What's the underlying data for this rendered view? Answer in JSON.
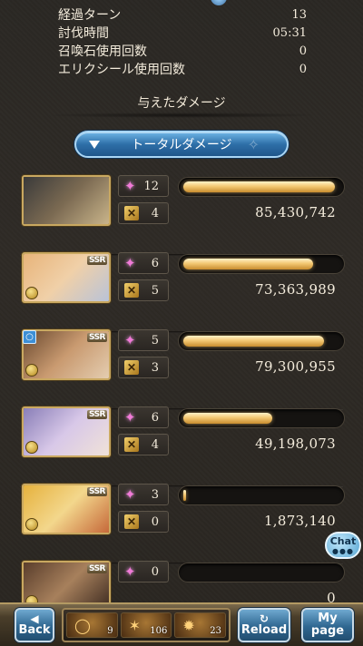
{
  "stats": {
    "rows": [
      {
        "label": "経過ターン",
        "value": "13"
      },
      {
        "label": "討伐時間",
        "value": "05:31"
      },
      {
        "label": "召喚石使用回数",
        "value": "0"
      },
      {
        "label": "エリクシール使用回数",
        "value": "0"
      }
    ]
  },
  "section_title": "与えたダメージ",
  "total_button": {
    "label": "トータルダメージ"
  },
  "characters": [
    {
      "stars": "12",
      "attacks": "4",
      "damage": "85,430,742",
      "bar_fraction": 0.97,
      "ssr": "",
      "art": [
        "#3a3a3a",
        "#7b6a52",
        "#c9b48a"
      ]
    },
    {
      "stars": "6",
      "attacks": "5",
      "damage": "73,363,989",
      "bar_fraction": 0.83,
      "ssr": "SSR",
      "art": [
        "#e8b47a",
        "#f0d0a8",
        "#b9c3d8"
      ]
    },
    {
      "stars": "5",
      "attacks": "3",
      "damage": "79,300,955",
      "bar_fraction": 0.9,
      "ssr": "SSR",
      "art": [
        "#6b4a30",
        "#c99a70",
        "#e4cdb0"
      ]
    },
    {
      "stars": "6",
      "attacks": "4",
      "damage": "49,198,073",
      "bar_fraction": 0.57,
      "ssr": "SSR",
      "art": [
        "#8a7fb8",
        "#d8c8e8",
        "#f0e2d8"
      ]
    },
    {
      "stars": "3",
      "attacks": "0",
      "damage": "1,873,140",
      "bar_fraction": 0.02,
      "ssr": "SSR",
      "art": [
        "#e6b23e",
        "#f3d78c",
        "#c6693a"
      ]
    },
    {
      "stars": "0",
      "attacks": "",
      "damage": "0",
      "bar_fraction": 0.0,
      "ssr": "SSR",
      "art": [
        "#5a3e2c",
        "#a7805c",
        "#3c2a20"
      ]
    }
  ],
  "chat": {
    "label": "Chat"
  },
  "footer": {
    "back": "Back",
    "reload": "Reload",
    "mypage": "My page",
    "items": [
      {
        "count": "9",
        "icon": "ring-icon"
      },
      {
        "count": "106",
        "icon": "claw-icon"
      },
      {
        "count": "23",
        "icon": "fire-icon"
      }
    ]
  },
  "colors": {
    "bar_gold": "#f3c873",
    "button_blue": "#2e6fa8",
    "gold_border": "#c9a860"
  }
}
